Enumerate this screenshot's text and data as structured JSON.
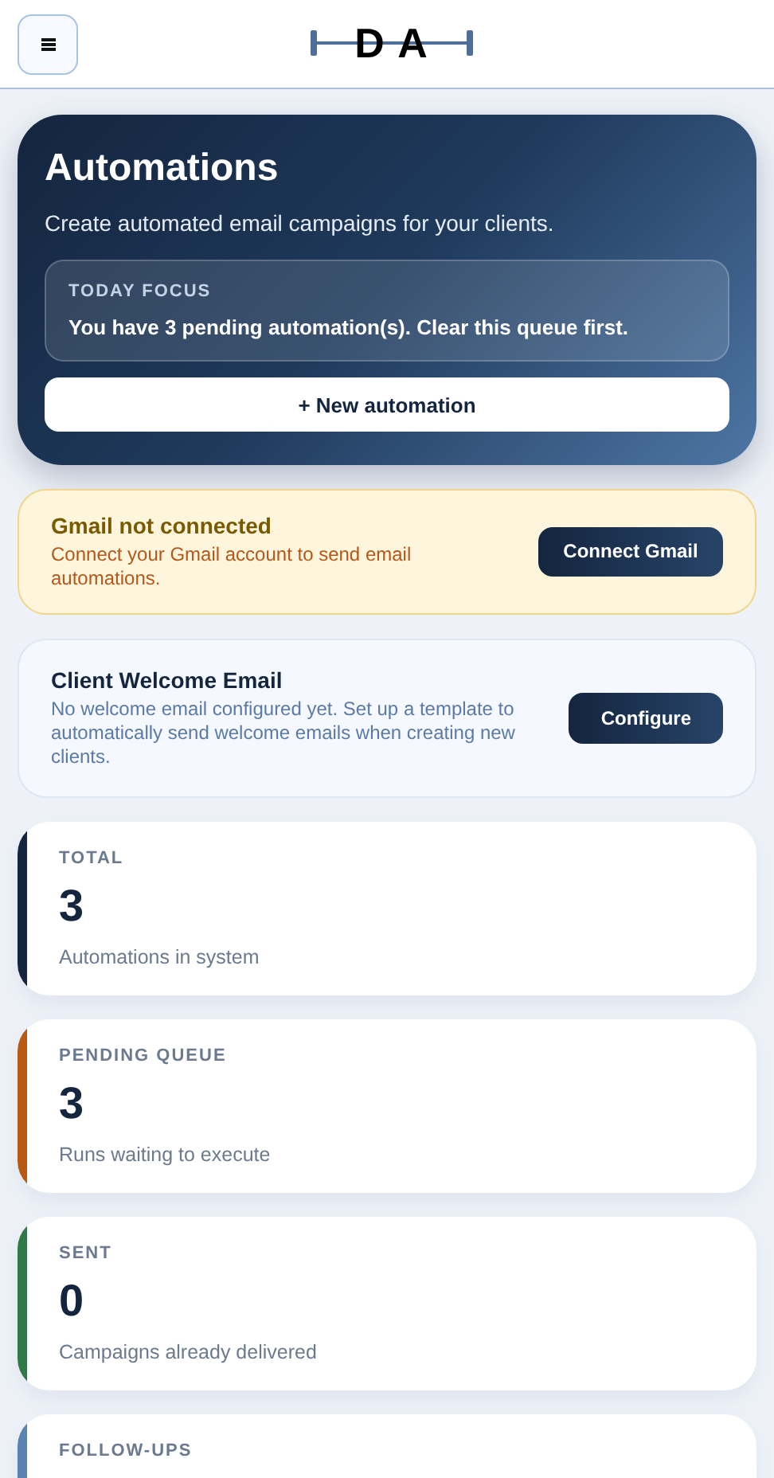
{
  "header": {
    "logo": "D A"
  },
  "hero": {
    "title": "Automations",
    "subtitle": "Create automated email campaigns for your clients.",
    "focus": {
      "label": "TODAY FOCUS",
      "text": "You have 3 pending automation(s). Clear this queue first."
    },
    "button": "+ New automation"
  },
  "notices": [
    {
      "kind": "warning",
      "title": "Gmail not connected",
      "text": "Connect your Gmail account to send email automations.",
      "button": "Connect Gmail"
    },
    {
      "kind": "info",
      "title": "Client Welcome Email",
      "text": "No welcome email configured yet. Set up a template to automatically send welcome emails when creating new clients.",
      "button": "Configure"
    }
  ],
  "stats": [
    {
      "label": "TOTAL",
      "value": "3",
      "caption": "Automations in system",
      "color": "#14263f"
    },
    {
      "label": "PENDING QUEUE",
      "value": "3",
      "caption": "Runs waiting to execute",
      "color": "#b85a14"
    },
    {
      "label": "SENT",
      "value": "0",
      "caption": "Campaigns already delivered",
      "color": "#2e7a47"
    },
    {
      "label": "FOLLOW-UPS",
      "color": "#5a82b4"
    }
  ]
}
